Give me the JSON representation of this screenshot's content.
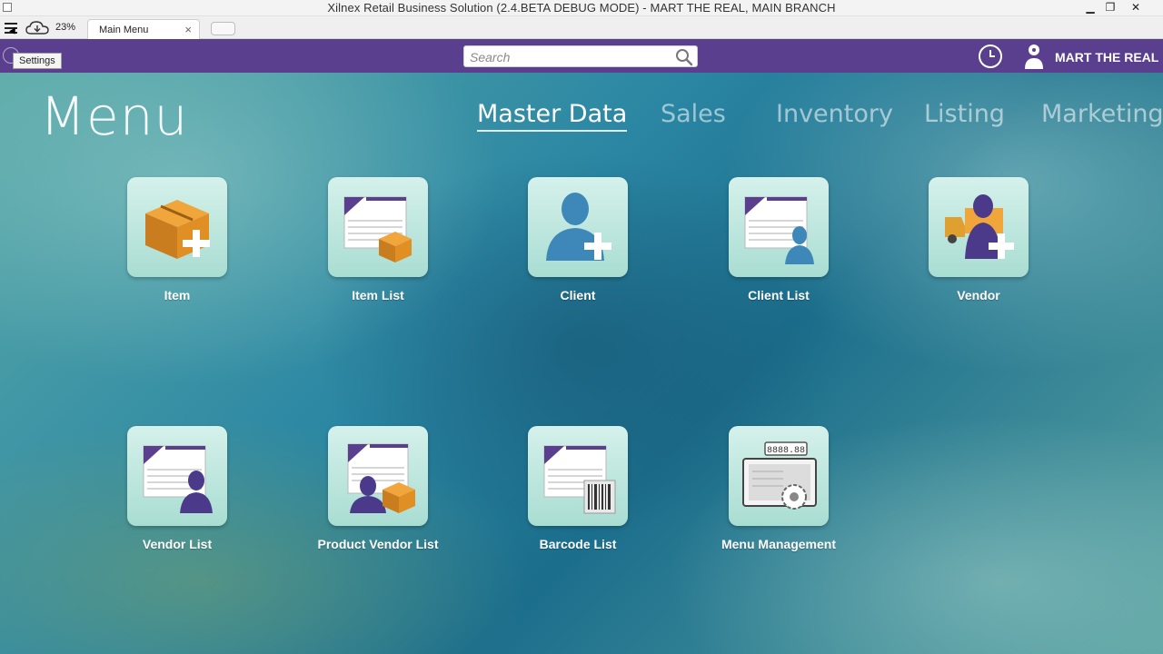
{
  "window": {
    "title": "Xilnex Retail Business Solution (2.4.BETA DEBUG MODE) - MART THE REAL, MAIN BRANCH",
    "minimize_glyph": "▁",
    "maximize_glyph": "❐",
    "close_glyph": "✕"
  },
  "tabstrip": {
    "sync_percent": "23%",
    "tabs": [
      {
        "label": "Main Menu",
        "close_glyph": "×"
      }
    ]
  },
  "toolbar": {
    "tooltip": "Settings",
    "search": {
      "placeholder": "Search"
    },
    "user_name": "MART THE REAL",
    "icons": [
      "hamburger-menu-icon",
      "cloud-download-icon",
      "globe-icon",
      "search-icon",
      "clock-icon",
      "user-icon"
    ]
  },
  "main": {
    "title": "Menu",
    "categories": [
      {
        "label": "Master Data",
        "active": true
      },
      {
        "label": "Sales",
        "active": false
      },
      {
        "label": "Inventory",
        "active": false
      },
      {
        "label": "Listing",
        "active": false
      },
      {
        "label": "Marketing",
        "active": false
      }
    ],
    "tiles": [
      {
        "label": "Item",
        "icon": "box-add-icon"
      },
      {
        "label": "Item List",
        "icon": "item-list-icon"
      },
      {
        "label": "Client",
        "icon": "client-add-icon"
      },
      {
        "label": "Client List",
        "icon": "client-list-icon"
      },
      {
        "label": "Vendor",
        "icon": "vendor-add-icon"
      },
      {
        "label": "Vendor List",
        "icon": "vendor-list-icon"
      },
      {
        "label": "Product Vendor List",
        "icon": "product-vendor-list-icon"
      },
      {
        "label": "Barcode List",
        "icon": "barcode-list-icon"
      },
      {
        "label": "Menu Management",
        "icon": "menu-management-icon"
      }
    ],
    "menu_management_display": "8888.88"
  },
  "colors": {
    "toolbar_purple": "#5a3f8e",
    "tile_bg": "#bfe8df",
    "box_orange": "#d98a2b",
    "client_blue": "#3d88b8",
    "vendor_purple": "#4b3a8a"
  }
}
